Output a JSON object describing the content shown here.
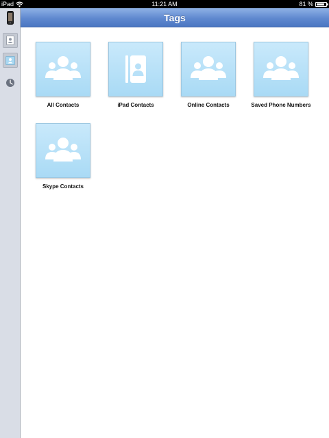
{
  "status_bar": {
    "device": "iPad",
    "time": "11:21 AM",
    "battery_percent": "81 %",
    "battery_level": 0.81
  },
  "sidebar": {
    "items": [
      {
        "name": "device",
        "icon": "iphone-icon"
      },
      {
        "name": "contacts",
        "icon": "contact-card-icon"
      },
      {
        "name": "tags",
        "icon": "tag-contacts-icon",
        "selected": true
      },
      {
        "name": "recent",
        "icon": "clock-icon"
      }
    ]
  },
  "header": {
    "title": "Tags"
  },
  "tags": [
    {
      "label": "All Contacts",
      "icon": "group-icon"
    },
    {
      "label": "iPad Contacts",
      "icon": "address-book-icon"
    },
    {
      "label": "Online Contacts",
      "icon": "group-icon"
    },
    {
      "label": "Saved Phone Numbers",
      "icon": "group-icon"
    },
    {
      "label": "Skype Contacts",
      "icon": "group-icon"
    }
  ],
  "colors": {
    "title_bar": "#5f88cf",
    "tile_bg": "#b8e1f8",
    "sidebar_bg": "#d9dde6"
  }
}
